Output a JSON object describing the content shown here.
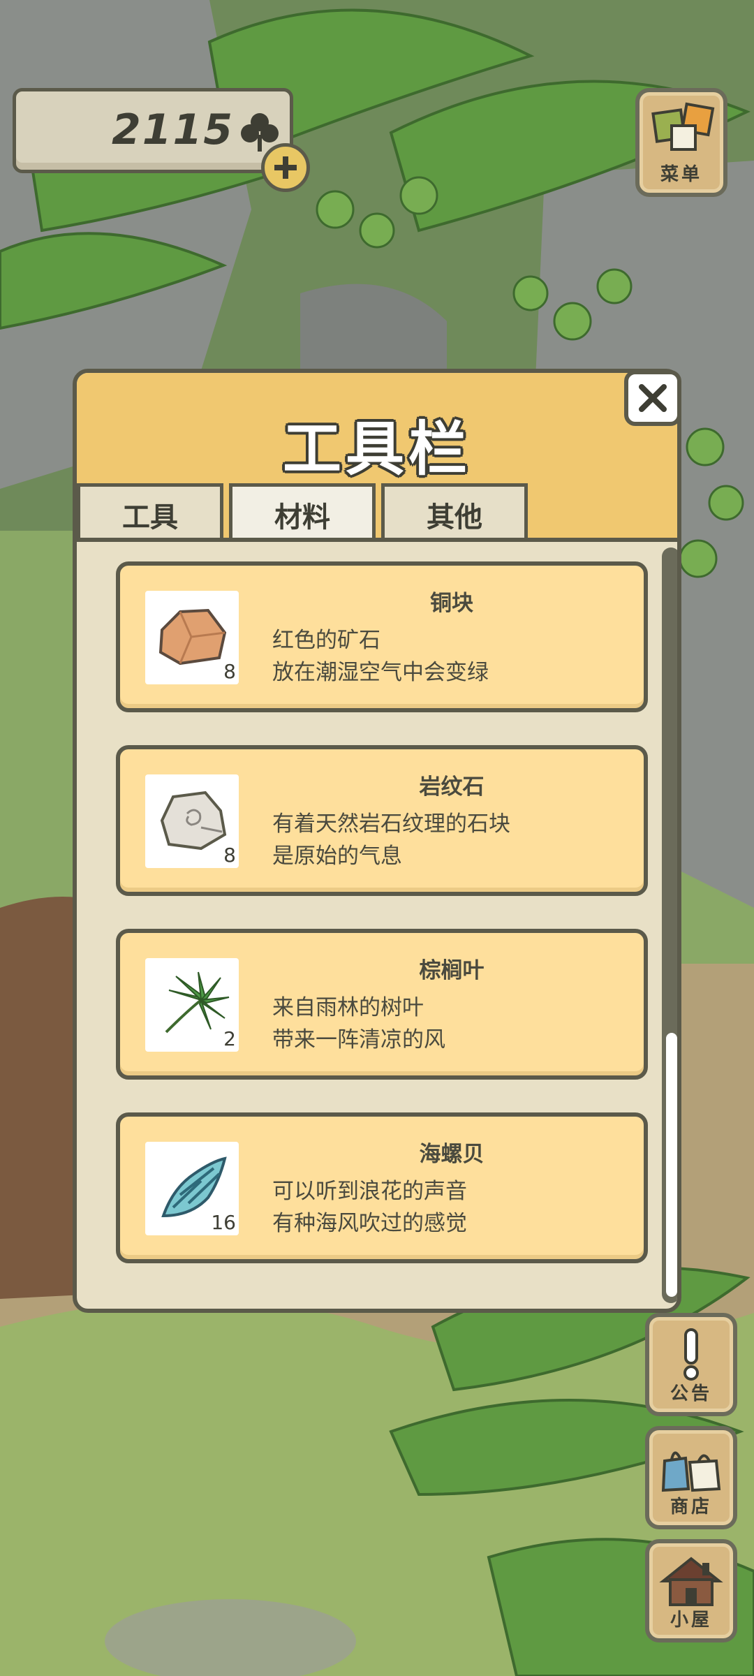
{
  "currency": {
    "amount": "2115",
    "icon": "clover-icon"
  },
  "menu_button": {
    "label": "菜单",
    "icon": "menu-cards-icon"
  },
  "dialog": {
    "title": "工具栏",
    "tabs": [
      {
        "label": "工具",
        "active": false
      },
      {
        "label": "材料",
        "active": true
      },
      {
        "label": "其他",
        "active": false
      }
    ],
    "items": [
      {
        "name": "铜块",
        "desc1": "红色的矿石",
        "desc2": "放在潮湿空气中会变绿",
        "count": "8",
        "icon": "copper-ore-icon"
      },
      {
        "name": "岩纹石",
        "desc1": "有着天然岩石纹理的石块",
        "desc2": "是原始的气息",
        "count": "8",
        "icon": "rock-stone-icon"
      },
      {
        "name": "棕榈叶",
        "desc1": "来自雨林的树叶",
        "desc2": "带来一阵清凉的风",
        "count": "2",
        "icon": "palm-leaf-icon"
      },
      {
        "name": "海螺贝",
        "desc1": "可以听到浪花的声音",
        "desc2": "有种海风吹过的感觉",
        "count": "16",
        "icon": "conch-shell-icon"
      }
    ]
  },
  "side_buttons": [
    {
      "label": "公告",
      "icon": "exclamation-icon"
    },
    {
      "label": "商店",
      "icon": "shop-bags-icon"
    },
    {
      "label": "小屋",
      "icon": "house-icon"
    }
  ],
  "colors": {
    "panel_header": "#f0c870",
    "card": "#fedf9c",
    "outline": "#5b5a4a"
  }
}
